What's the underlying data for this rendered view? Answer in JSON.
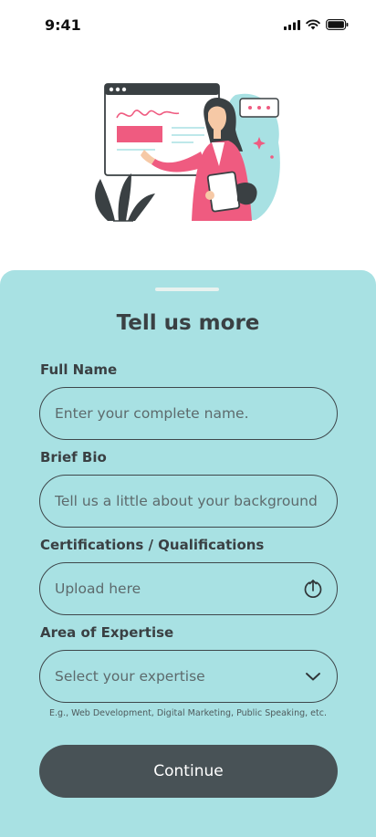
{
  "status_bar": {
    "time": "9:41"
  },
  "sheet": {
    "title": "Tell us more",
    "fields": [
      {
        "label": "Full Name",
        "placeholder": "Enter your complete name.",
        "icon": ""
      },
      {
        "label": "Brief Bio",
        "placeholder": "Tell us a little about your background",
        "icon": ""
      },
      {
        "label": "Certifications / Qualifications",
        "placeholder": "Upload here",
        "icon": "upload-icon"
      },
      {
        "label": "Area of Expertise",
        "placeholder": "Select your expertise",
        "icon": "chevron-down-icon"
      }
    ],
    "expertise_hint": "E.g., Web Development, Digital Marketing, Public Speaking, etc.",
    "continue_label": "Continue"
  },
  "colors": {
    "sheet_bg": "#a8e1e3",
    "button_bg": "#485256",
    "accent_pink": "#ef5b80",
    "text_dark": "#3a4043"
  }
}
